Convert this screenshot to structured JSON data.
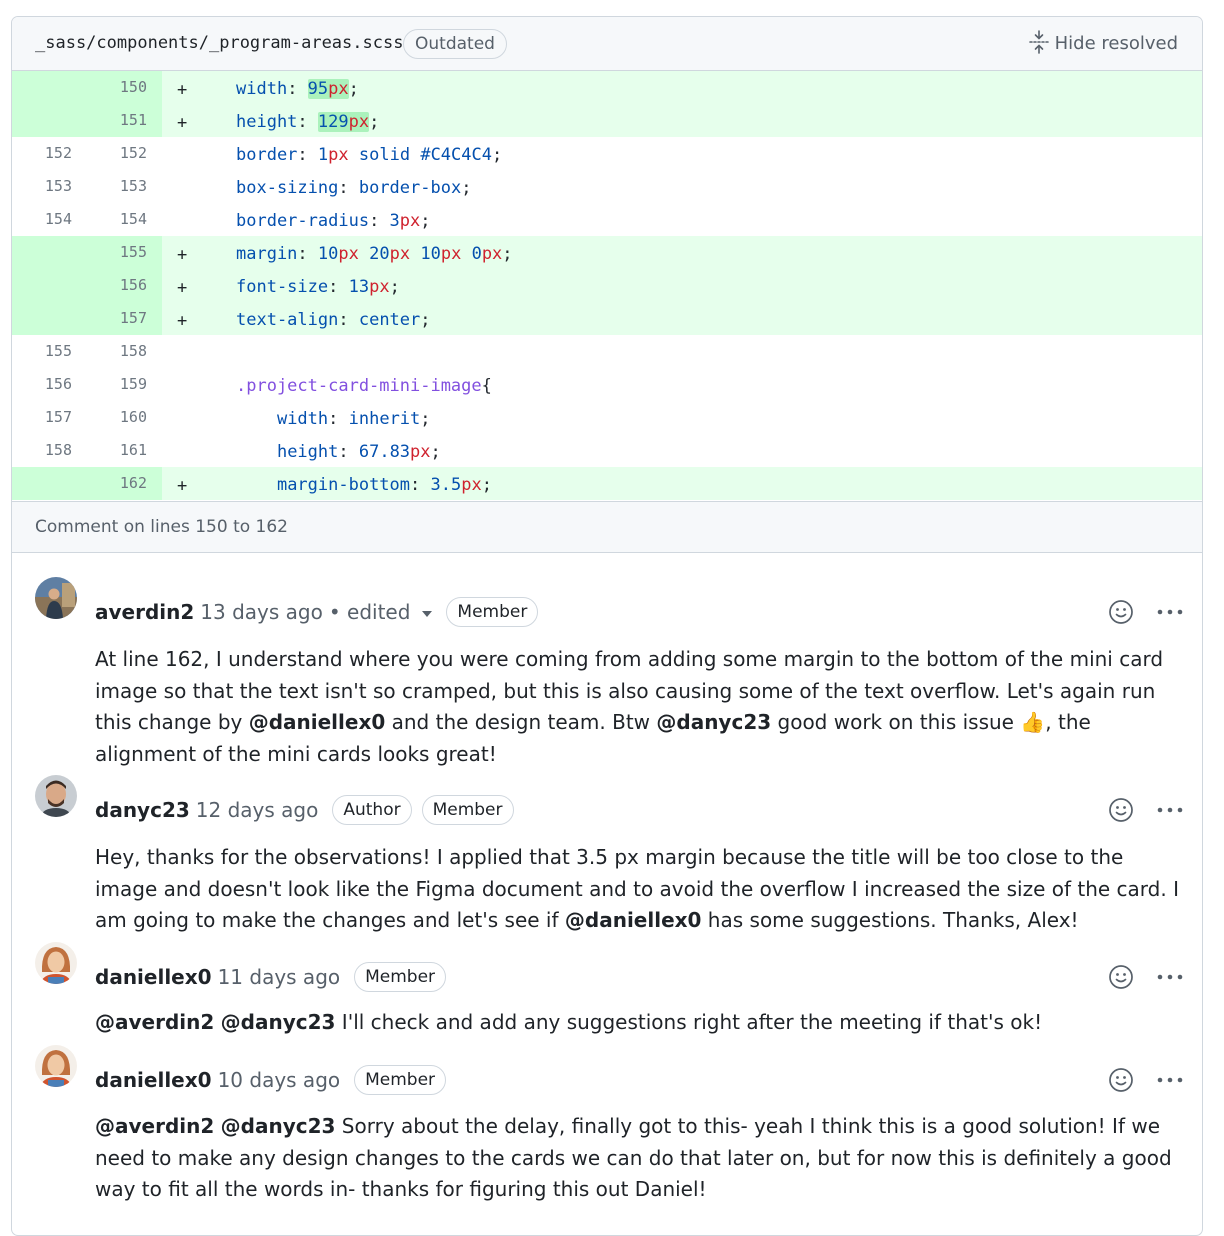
{
  "file": {
    "path": "_sass/components/_program-areas.scss",
    "status_badge": "Outdated",
    "hide_resolved_label": "Hide resolved"
  },
  "diff_lines": [
    {
      "old": "",
      "new": "150",
      "sign": "+",
      "code": "width: 95px;"
    },
    {
      "old": "",
      "new": "151",
      "sign": "+",
      "code": "height: 129px;"
    },
    {
      "old": "152",
      "new": "152",
      "sign": "",
      "code": "border: 1px solid #C4C4C4;"
    },
    {
      "old": "153",
      "new": "153",
      "sign": "",
      "code": "box-sizing: border-box;"
    },
    {
      "old": "154",
      "new": "154",
      "sign": "",
      "code": "border-radius: 3px;"
    },
    {
      "old": "",
      "new": "155",
      "sign": "+",
      "code": "margin: 10px 20px 10px 0px;"
    },
    {
      "old": "",
      "new": "156",
      "sign": "+",
      "code": "font-size: 13px;"
    },
    {
      "old": "",
      "new": "157",
      "sign": "+",
      "code": "text-align: center;"
    },
    {
      "old": "155",
      "new": "158",
      "sign": "",
      "code": ""
    },
    {
      "old": "156",
      "new": "159",
      "sign": "",
      "code": ".project-card-mini-image{"
    },
    {
      "old": "157",
      "new": "160",
      "sign": "",
      "code": "width: inherit;"
    },
    {
      "old": "158",
      "new": "161",
      "sign": "",
      "code": "height: 67.83px;"
    },
    {
      "old": "",
      "new": "162",
      "sign": "+",
      "code": "margin-bottom: 3.5px;"
    }
  ],
  "comment_on_label": "Comment on lines 150 to 162",
  "comments": [
    {
      "author": "averdin2",
      "time": "13 days ago",
      "edited": "• edited",
      "badges": [
        "Member"
      ],
      "body_parts": [
        "At line 162, I understand where you were coming from adding some margin to the bottom of the mini card image so that the text isn't so cramped, but this is also causing some of the text overflow. Let's again run this change by ",
        "@daniellex0",
        " and the design team. Btw ",
        "@danyc23",
        " good work on this issue ",
        "👍",
        ", the alignment of the mini cards looks great!"
      ]
    },
    {
      "author": "danyc23",
      "time": "12 days ago",
      "badges": [
        "Author",
        "Member"
      ],
      "body_parts": [
        "Hey, thanks for the observations! I applied that 3.5 px margin because the title will be too close to the image and doesn't look like the Figma document and to avoid the overflow I increased the size of the card. I am going to make the changes and let's see if ",
        "@daniellex0",
        " has some suggestions. Thanks, Alex!"
      ]
    },
    {
      "author": "daniellex0",
      "time": "11 days ago",
      "badges": [
        "Member"
      ],
      "body_parts": [
        "@averdin2",
        " ",
        "@danyc23",
        " I'll check and add any suggestions right after the meeting if that's ok!"
      ]
    },
    {
      "author": "daniellex0",
      "time": "10 days ago",
      "badges": [
        "Member"
      ],
      "body_parts": [
        "@averdin2",
        " ",
        "@danyc23",
        " Sorry about the delay, finally got to this- yeah I think this is a good solution! If we need to make any design changes to the cards we can do that later on, but for now this is definitely a good way to fit all the words in- thanks for figuring this out Daniel!"
      ]
    }
  ],
  "colors": {
    "added_bg": "#e6ffec",
    "added_gutter": "#ccffd8",
    "border": "#d0d7de",
    "muted_text": "#57606a"
  },
  "icons": [
    "unfold-icon",
    "smiley-icon",
    "kebab-horizontal-icon",
    "thumbs-up-emoji"
  ]
}
